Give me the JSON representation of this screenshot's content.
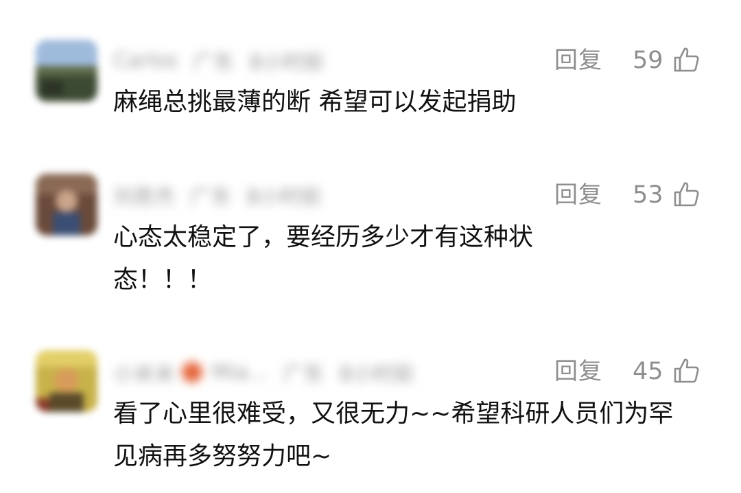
{
  "reply_label": "回复",
  "icons": {
    "like": "thumbs-up-icon"
  },
  "comments": [
    {
      "username": "Carlos",
      "region": "广东",
      "time": "8小时前",
      "likes": "59",
      "text": "麻绳总挑最薄的断 希望可以发起捐助"
    },
    {
      "username": "刘思杰",
      "region": "广东",
      "time": "8小时前",
      "likes": "53",
      "text": "心态太稳定了，要经历多少才有这种状态！！！"
    },
    {
      "username": "小米米",
      "username_tail": "Mia...",
      "region": "广东",
      "time": "8小时前",
      "likes": "45",
      "text": "看了心里很难受，又很无力~~希望科研人员们为罕见病再多努努力吧~"
    }
  ]
}
